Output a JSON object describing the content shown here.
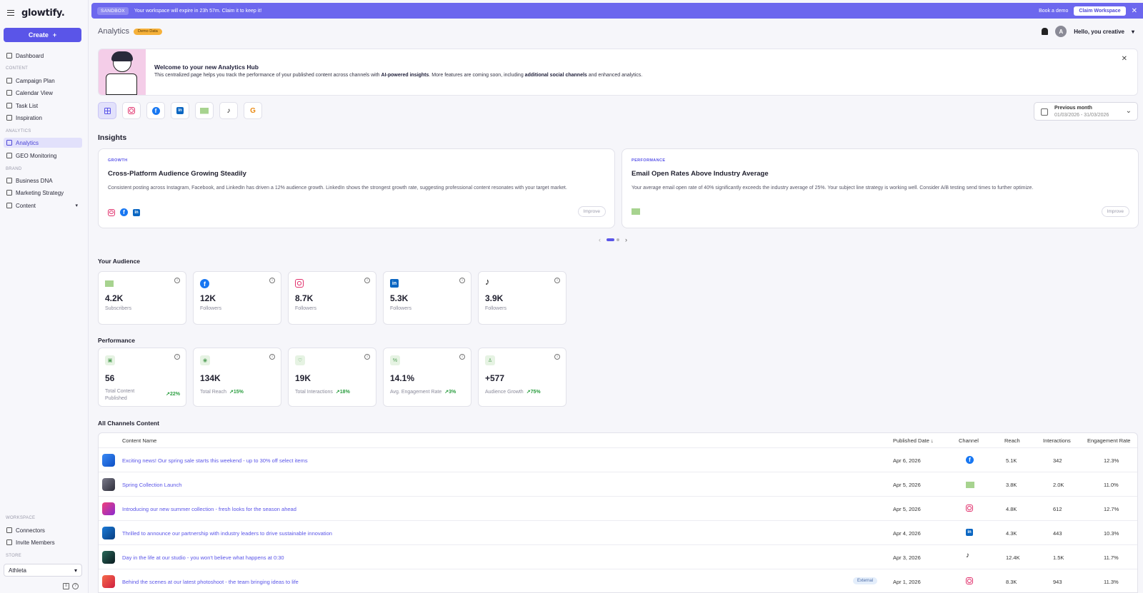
{
  "app": {
    "name": "glowtify."
  },
  "sidebar": {
    "create_label": "Create",
    "dashboard": "Dashboard",
    "content_section": "CONTENT",
    "content_items": [
      "Campaign Plan",
      "Calendar View",
      "Task List",
      "Inspiration"
    ],
    "analytics_section": "ANALYTICS",
    "analytics_items": [
      "Analytics",
      "GEO Monitoring"
    ],
    "brand_section": "BRAND",
    "brand_items": [
      "Business DNA",
      "Marketing Strategy",
      "Content"
    ],
    "workspace_section": "WORKSPACE",
    "workspace_items": [
      "Connectors",
      "Invite Members"
    ],
    "store_section": "STORE",
    "store_value": "Athleta"
  },
  "banner": {
    "tag": "SANDBOX",
    "message": "Your workspace will expire in 23h 57m. Claim it to keep it!",
    "book_demo": "Book a demo",
    "claim": "Claim Workspace"
  },
  "header": {
    "title": "Analytics",
    "badge": "Demo Data",
    "greeting": "Hello, you creative",
    "avatar_letter": "A"
  },
  "welcome": {
    "title": "Welcome to your new Analytics Hub",
    "text_a": "This centralized page helps you track the performance of your published content across channels with ",
    "text_b": "AI-powered insights",
    "text_c": ". More features are coming soon, including ",
    "text_d": "additional social channels",
    "text_e": " and enhanced analytics."
  },
  "date_filter": {
    "label": "Previous month",
    "range": "01/03/2026 - 31/03/2026"
  },
  "insights": {
    "title": "Insights",
    "cards": [
      {
        "tag": "GROWTH",
        "title": "Cross-Platform Audience Growing Steadily",
        "text": "Consistent posting across Instagram, Facebook, and LinkedIn has driven a 12% audience growth. LinkedIn shows the strongest growth rate, suggesting professional content resonates with your target market.",
        "button": "Improve"
      },
      {
        "tag": "PERFORMANCE",
        "title": "Email Open Rates Above Industry Average",
        "text": "Your average email open rate of 40% significantly exceeds the industry average of 25%. Your subject line strategy is working well. Consider A/B testing send times to further optimize.",
        "button": "Improve"
      }
    ]
  },
  "audience": {
    "title": "Your Audience",
    "cards": [
      {
        "icon": "mail-icon",
        "value": "4.2K",
        "label": "Subscribers"
      },
      {
        "icon": "facebook-icon",
        "value": "12K",
        "label": "Followers"
      },
      {
        "icon": "instagram-icon",
        "value": "8.7K",
        "label": "Followers"
      },
      {
        "icon": "linkedin-icon",
        "value": "5.3K",
        "label": "Followers"
      },
      {
        "icon": "tiktok-icon",
        "value": "3.9K",
        "label": "Followers"
      }
    ]
  },
  "performance": {
    "title": "Performance",
    "cards": [
      {
        "value": "56",
        "label_1": "Total Content",
        "label_2": "Published",
        "delta": "↗22%"
      },
      {
        "value": "134K",
        "label_1": "Total Reach",
        "delta": "↗15%"
      },
      {
        "value": "19K",
        "label_1": "Total Interactions",
        "delta": "↗18%"
      },
      {
        "value": "14.1%",
        "label_1": "Avg. Engagement Rate",
        "delta": "↗3%"
      },
      {
        "value": "+577",
        "label_1": "Audience Growth",
        "delta": "↗75%"
      }
    ]
  },
  "table": {
    "title": "All Channels Content",
    "headers": {
      "name": "Content Name",
      "date": "Published Date",
      "channel": "Channel",
      "reach": "Reach",
      "interactions": "Interactions",
      "engagement": "Engagement Rate"
    },
    "rows": [
      {
        "name": "Exciting news! Our spring sale starts this weekend - up to 30% off select items",
        "date": "Apr 6, 2026",
        "channel": "facebook",
        "reach": "5.1K",
        "interactions": "342",
        "engagement": "12.3%",
        "thumb": "#1f6fe0"
      },
      {
        "name": "Spring Collection Launch",
        "date": "Apr 5, 2026",
        "channel": "email",
        "reach": "3.8K",
        "interactions": "2.0K",
        "engagement": "11.0%",
        "thumb": "#4a4a5a"
      },
      {
        "name": "Introducing our new summer collection - fresh looks for the season ahead",
        "date": "Apr 5, 2026",
        "channel": "instagram",
        "reach": "4.8K",
        "interactions": "612",
        "engagement": "12.7%",
        "thumb": "#d2306c"
      },
      {
        "name": "Thrilled to announce our partnership with industry leaders to drive sustainable innovation",
        "date": "Apr 4, 2026",
        "channel": "linkedin",
        "reach": "4.3K",
        "interactions": "443",
        "engagement": "10.3%",
        "thumb": "#0a5aa8"
      },
      {
        "name": "Day in the life at our studio - you won't believe what happens at 0:30",
        "date": "Apr 3, 2026",
        "channel": "tiktok",
        "reach": "12.4K",
        "interactions": "1.5K",
        "engagement": "11.7%",
        "thumb": "#1a3a3a"
      },
      {
        "name": "Behind the scenes at our latest photoshoot - the team bringing ideas to life",
        "date": "Apr 1, 2026",
        "channel": "instagram",
        "reach": "8.3K",
        "interactions": "943",
        "engagement": "11.3%",
        "thumb": "#e8404a",
        "badge": "External"
      }
    ]
  }
}
